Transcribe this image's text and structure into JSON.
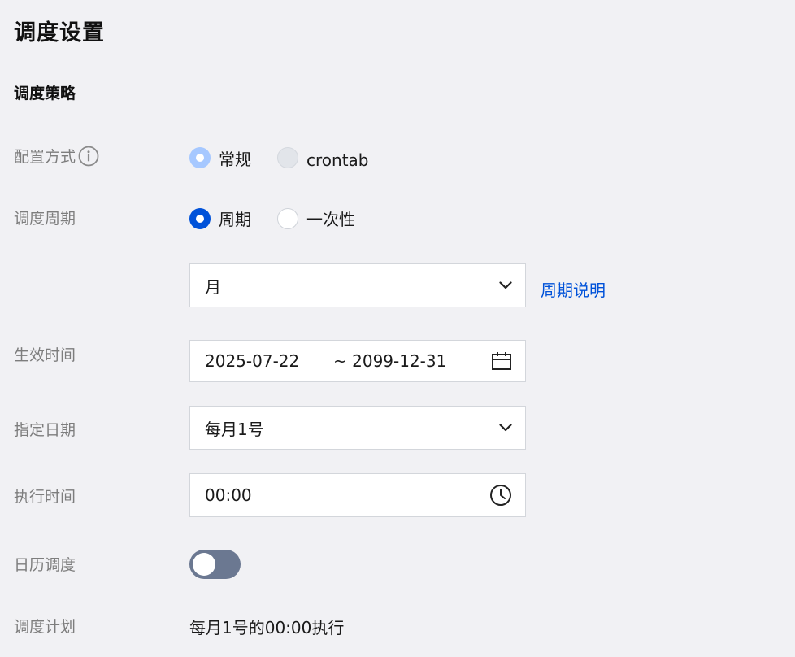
{
  "page": {
    "title": "调度设置",
    "section_title": "调度策略"
  },
  "config_method": {
    "label": "配置方式",
    "options": [
      {
        "label": "常规",
        "selected": true
      },
      {
        "label": "crontab",
        "selected": false
      }
    ]
  },
  "schedule_cycle": {
    "label": "调度周期",
    "options": [
      {
        "label": "周期",
        "selected": true
      },
      {
        "label": "一次性",
        "selected": false
      }
    ],
    "period_value": "月",
    "period_help_link": "周期说明"
  },
  "effective_time": {
    "label": "生效时间",
    "start": "2025-07-22",
    "end": "~ 2099-12-31"
  },
  "specified_date": {
    "label": "指定日期",
    "value": "每月1号"
  },
  "execute_time": {
    "label": "执行时间",
    "value": "00:00"
  },
  "calendar_schedule": {
    "label": "日历调度",
    "enabled": false
  },
  "schedule_plan": {
    "label": "调度计划",
    "value": "每月1号的00:00执行"
  },
  "icons": {
    "info": "info-icon",
    "chevron": "chevron-down-icon",
    "calendar": "calendar-icon",
    "clock": "clock-icon"
  },
  "colors": {
    "primary": "#0052d9",
    "primary_light": "#a6c8ff",
    "toggle_off": "#6b7891",
    "background": "#f1f1f4"
  }
}
